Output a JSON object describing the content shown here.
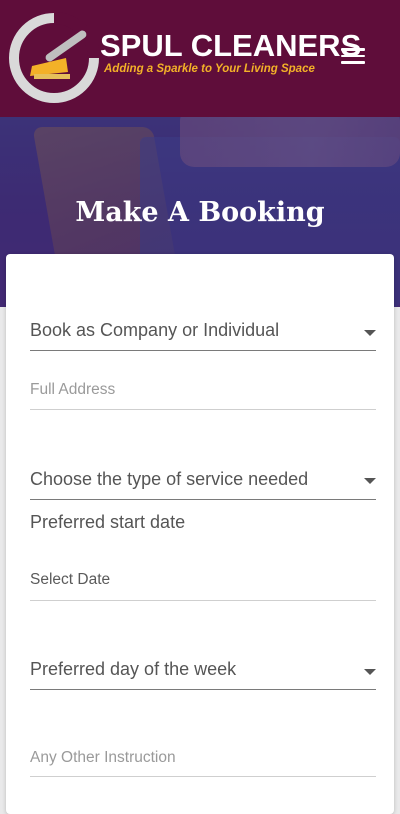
{
  "header": {
    "brand_name": "SPUL CLEANERS",
    "tagline": "Adding a Sparkle to Your Living Space",
    "menu_icon": "hamburger-menu-icon",
    "background_color": "#5f0d3a",
    "accent_color": "#f3b128"
  },
  "hero": {
    "title": "Make A Booking"
  },
  "form": {
    "booking_type": {
      "value": "Book as Company or Individual",
      "icon": "dropdown-caret-icon"
    },
    "full_address": {
      "placeholder": "Full Address"
    },
    "service_type": {
      "value": "Choose the type of service needed",
      "icon": "dropdown-caret-icon"
    },
    "start_date_label": "Preferred start date",
    "select_date": {
      "placeholder": "Select Date"
    },
    "preferred_day": {
      "value": "Preferred day of the week",
      "icon": "dropdown-caret-icon"
    },
    "other_instruction": {
      "placeholder": "Any Other Instruction"
    }
  }
}
